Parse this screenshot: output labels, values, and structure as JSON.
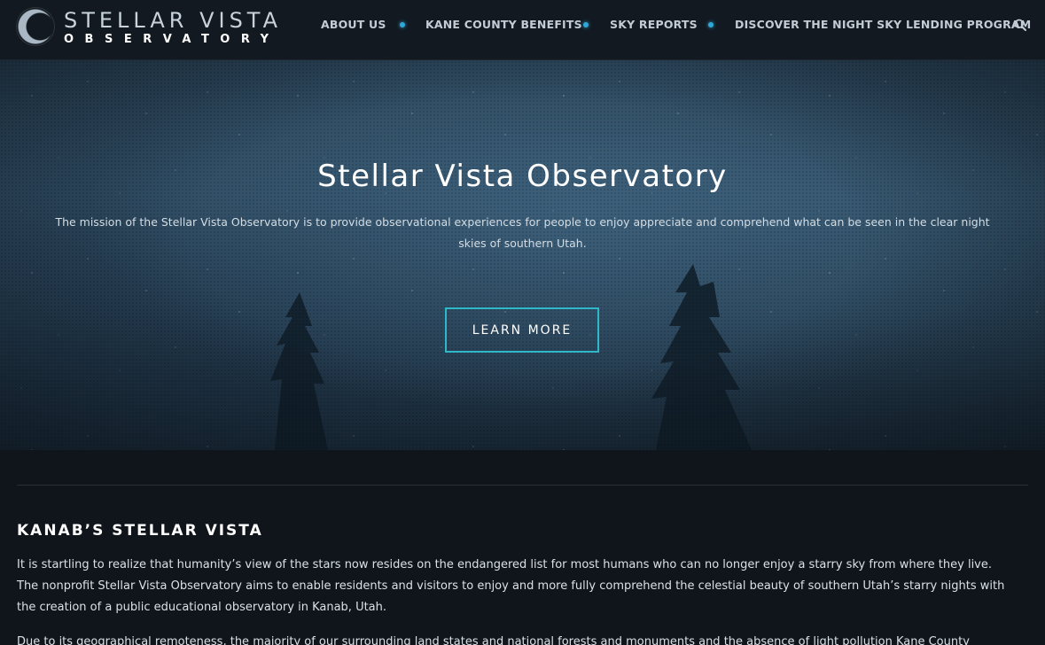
{
  "header": {
    "logo_title": "STELLAR VISTA",
    "logo_subtitle": "OBSERVATORY",
    "nav": [
      {
        "label": "ABOUT US"
      },
      {
        "label": "KANE COUNTY BENEFITS"
      },
      {
        "label": "SKY REPORTS"
      },
      {
        "label": "DISCOVER THE NIGHT SKY LENDING PROGRAM"
      }
    ],
    "search_icon": "search-icon"
  },
  "hero": {
    "title": "Stellar Vista Observatory",
    "text": "The mission of the Stellar Vista Observatory is to provide observational experiences for people to enjoy appreciate and comprehend what can be seen in the clear night skies of southern Utah.",
    "button": "LEARN MORE"
  },
  "section": {
    "title": "KANAB’S STELLAR VISTA",
    "paragraph1": "It is startling to realize that humanity’s view of the stars now resides on the endangered list for most humans who can no longer enjoy a starry sky from where they live. The nonprofit Stellar Vista Observatory aims to enable residents and visitors to enjoy and more fully comprehend the celestial beauty of southern Utah’s starry nights with the creation of a public educational observatory in Kanab, Utah.",
    "paragraph2": "Due to its geographical remoteness, the majority of our surrounding land states and national forests and monuments and the absence of light pollution Kane County"
  },
  "colors": {
    "accent": "#2fb8c7",
    "nav_dot": "#2ea8d6",
    "header_bg": "#121920",
    "page_bg": "#0f151b"
  }
}
